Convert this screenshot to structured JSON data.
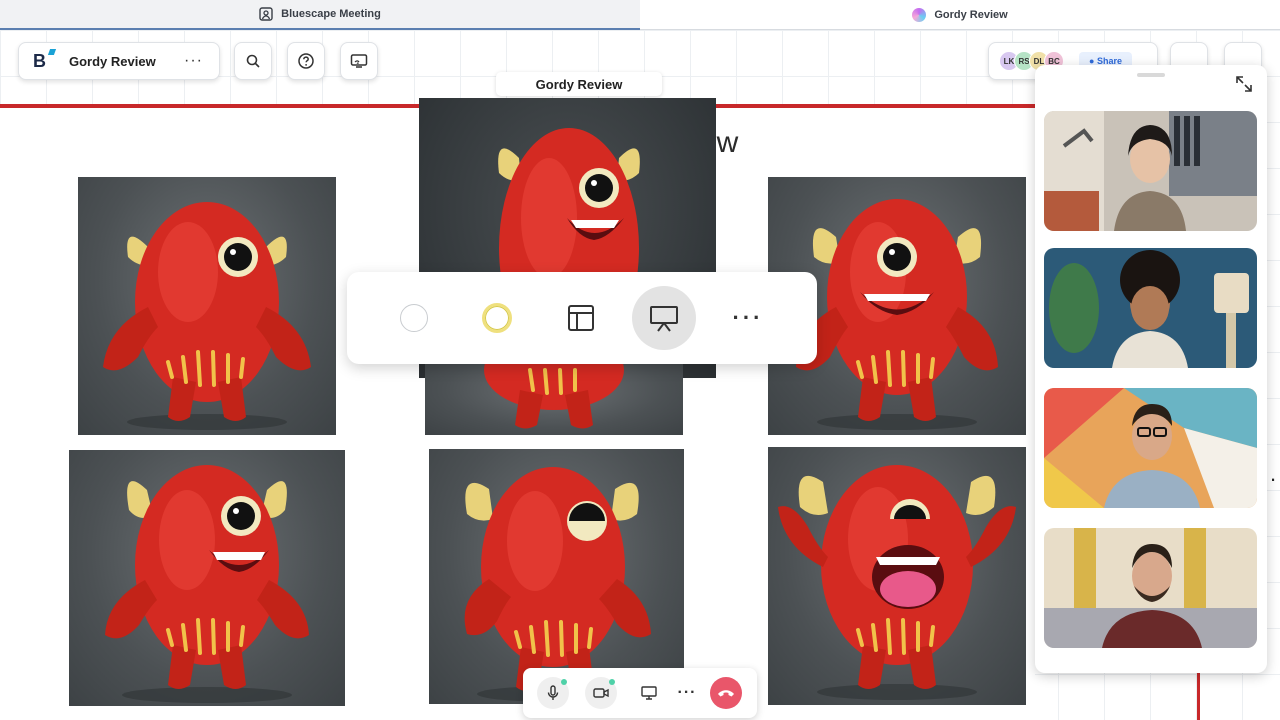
{
  "tabs": [
    {
      "label": "Bluescape Meeting",
      "icon": "meeting-icon",
      "active": false
    },
    {
      "label": "Gordy Review",
      "icon": "bluescape-orb-icon",
      "active": true
    }
  ],
  "workspace": {
    "logo": "B",
    "name": "Gordy Review",
    "more": "···"
  },
  "toolbar": {
    "search_icon": "search-icon",
    "help_icon": "help-icon",
    "present_icon": "present-icon"
  },
  "collaborators": {
    "avatars": [
      {
        "initials": "LK",
        "color": "#d8c8f0"
      },
      {
        "initials": "RS",
        "color": "#b6e3c6"
      },
      {
        "initials": "DL",
        "color": "#f0e0a8"
      },
      {
        "initials": "BC",
        "color": "#f0c2d8"
      }
    ],
    "share_label": "Share"
  },
  "board": {
    "label": "Gordy Review",
    "title_fragment": "ew"
  },
  "action_bar": {
    "items": [
      "empty-circle",
      "yellow-circle",
      "layout-icon",
      "present-icon",
      "more-icon"
    ],
    "more_label": "···"
  },
  "video_panel": {
    "participants": [
      {
        "name": "participant-1",
        "bg": "#c9c2b8"
      },
      {
        "name": "participant-2",
        "bg": "#2c5a78"
      },
      {
        "name": "participant-3",
        "bg": "#e8a45a"
      },
      {
        "name": "participant-4",
        "bg": "#e8ddc8"
      }
    ]
  },
  "call_controls": {
    "more_label": "···"
  },
  "colors": {
    "accent_red": "#c8282a",
    "end_call": "#e9566a",
    "monster_red": "#d42a22",
    "horn_yellow": "#e8d27a"
  }
}
